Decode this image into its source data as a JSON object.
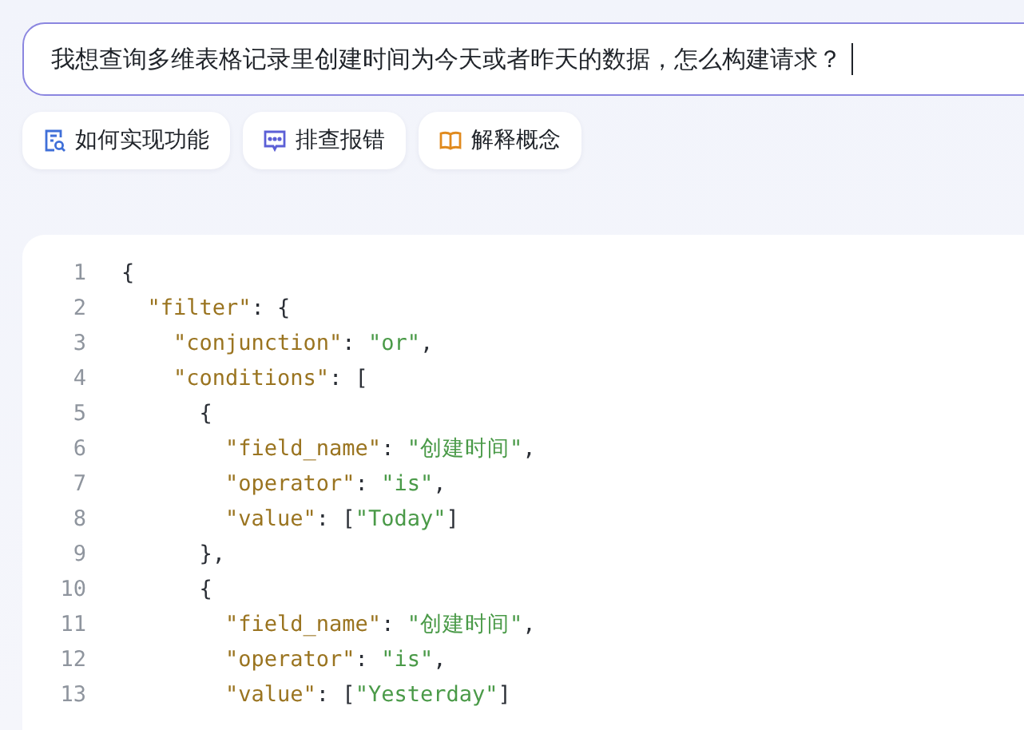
{
  "prompt": {
    "value": "我想查询多维表格记录里创建时间为今天或者昨天的数据，怎么构建请求？"
  },
  "chips": [
    {
      "label": "如何实现功能",
      "kind": "doc"
    },
    {
      "label": "排查报错",
      "kind": "chat"
    },
    {
      "label": "解释概念",
      "kind": "book"
    }
  ],
  "code": {
    "lines": [
      {
        "number": "1",
        "tokens": [
          {
            "kind": "punct",
            "text": "{"
          }
        ],
        "children": [
          {
            "number": "2",
            "tokens": [
              {
                "kind": "key",
                "text": "\"filter\""
              },
              {
                "kind": "punct",
                "text": ": {"
              }
            ],
            "children": [
              {
                "number": "3",
                "tokens": [
                  {
                    "kind": "key",
                    "text": "\"conjunction\""
                  },
                  {
                    "kind": "punct",
                    "text": ": "
                  },
                  {
                    "kind": "string",
                    "text": "\"or\""
                  },
                  {
                    "kind": "punct",
                    "text": ","
                  }
                ]
              },
              {
                "number": "4",
                "tokens": [
                  {
                    "kind": "key",
                    "text": "\"conditions\""
                  },
                  {
                    "kind": "punct",
                    "text": ": ["
                  }
                ],
                "children": [
                  {
                    "number": "5",
                    "tokens": [
                      {
                        "kind": "punct",
                        "text": "{"
                      }
                    ],
                    "children": [
                      {
                        "number": "6",
                        "tokens": [
                          {
                            "kind": "key",
                            "text": "\"field_name\""
                          },
                          {
                            "kind": "punct",
                            "text": ": "
                          },
                          {
                            "kind": "string",
                            "text": "\"创建时间\""
                          },
                          {
                            "kind": "punct",
                            "text": ","
                          }
                        ]
                      },
                      {
                        "number": "7",
                        "tokens": [
                          {
                            "kind": "key",
                            "text": "\"operator\""
                          },
                          {
                            "kind": "punct",
                            "text": ": "
                          },
                          {
                            "kind": "string",
                            "text": "\"is\""
                          },
                          {
                            "kind": "punct",
                            "text": ","
                          }
                        ]
                      },
                      {
                        "number": "8",
                        "tokens": [
                          {
                            "kind": "key",
                            "text": "\"value\""
                          },
                          {
                            "kind": "punct",
                            "text": ": ["
                          },
                          {
                            "kind": "string",
                            "text": "\"Today\""
                          },
                          {
                            "kind": "punct",
                            "text": "]"
                          }
                        ]
                      }
                    ]
                  },
                  {
                    "number": "9",
                    "tokens": [
                      {
                        "kind": "punct",
                        "text": "},"
                      }
                    ]
                  },
                  {
                    "number": "10",
                    "tokens": [
                      {
                        "kind": "punct",
                        "text": "{"
                      }
                    ],
                    "children": [
                      {
                        "number": "11",
                        "tokens": [
                          {
                            "kind": "key",
                            "text": "\"field_name\""
                          },
                          {
                            "kind": "punct",
                            "text": ": "
                          },
                          {
                            "kind": "string",
                            "text": "\"创建时间\""
                          },
                          {
                            "kind": "punct",
                            "text": ","
                          }
                        ]
                      },
                      {
                        "number": "12",
                        "tokens": [
                          {
                            "kind": "key",
                            "text": "\"operator\""
                          },
                          {
                            "kind": "punct",
                            "text": ": "
                          },
                          {
                            "kind": "string",
                            "text": "\"is\""
                          },
                          {
                            "kind": "punct",
                            "text": ","
                          }
                        ]
                      },
                      {
                        "number": "13",
                        "tokens": [
                          {
                            "kind": "key",
                            "text": "\"value\""
                          },
                          {
                            "kind": "punct",
                            "text": ": ["
                          },
                          {
                            "kind": "string",
                            "text": "\"Yesterday\""
                          },
                          {
                            "kind": "punct",
                            "text": "]"
                          }
                        ]
                      }
                    ]
                  }
                ]
              }
            ]
          }
        ]
      }
    ]
  }
}
